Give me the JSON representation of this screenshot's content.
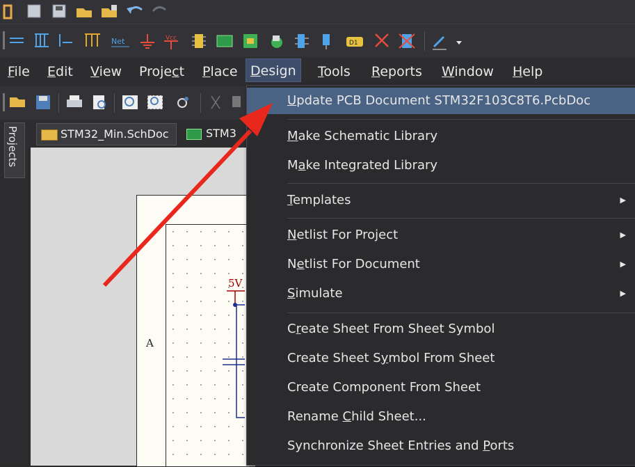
{
  "menubar": {
    "items": [
      {
        "label": "File",
        "ul": "F",
        "rest": "ile"
      },
      {
        "label": "Edit",
        "ul": "E",
        "rest": "dit"
      },
      {
        "label": "View",
        "ul": "V",
        "rest": "iew"
      },
      {
        "label": "Project",
        "pre": "Proje",
        "ul": "c",
        "rest": "t"
      },
      {
        "label": "Place",
        "ul": "P",
        "rest": "lace"
      },
      {
        "label": "Design",
        "ul": "D",
        "rest": "esign"
      },
      {
        "label": "Tools",
        "ul": "T",
        "rest": "ools"
      },
      {
        "label": "Reports",
        "ul": "R",
        "rest": "eports"
      },
      {
        "label": "Window",
        "ul": "W",
        "rest": "indow"
      },
      {
        "label": "Help",
        "ul": "H",
        "rest": "elp"
      }
    ]
  },
  "toolbar_text": {
    "netlabel": "Net",
    "vcc": "Vcc",
    "d1": "D1"
  },
  "panel": {
    "projects_label": "Projects"
  },
  "doc_tabs": [
    {
      "label": "STM32_Min.SchDoc"
    },
    {
      "label": "STM3"
    }
  ],
  "schematic": {
    "zone_label": "A",
    "net_label": "5V"
  },
  "design_menu": {
    "items": [
      {
        "pre": "",
        "ul": "U",
        "rest": "pdate PCB Document STM32F103C8T6.PcbDoc",
        "submenu": false,
        "highlighted": true
      },
      {
        "pre": "",
        "ul": "M",
        "rest": "ake Schematic Library",
        "submenu": false
      },
      {
        "pre": "M",
        "ul": "a",
        "rest": "ke Integrated Library",
        "submenu": false
      },
      {
        "pre": "",
        "ul": "T",
        "rest": "emplates",
        "submenu": true
      },
      {
        "pre": "",
        "ul": "N",
        "rest": "etlist For Project",
        "submenu": true
      },
      {
        "pre": "N",
        "ul": "e",
        "rest": "tlist For Document",
        "submenu": true
      },
      {
        "pre": "",
        "ul": "S",
        "rest": "imulate",
        "submenu": true
      },
      {
        "pre": "C",
        "ul": "r",
        "rest": "eate Sheet From Sheet Symbol",
        "submenu": false
      },
      {
        "pre": "Create Sheet S",
        "ul": "y",
        "rest": "mbol From Sheet",
        "submenu": false
      },
      {
        "pre": "Create Component From Sheet",
        "ul": "",
        "rest": "",
        "submenu": false
      },
      {
        "pre": "Rename ",
        "ul": "C",
        "rest": "hild Sheet...",
        "submenu": false
      },
      {
        "pre": "Synchronize Sheet Entries and ",
        "ul": "P",
        "rest": "orts",
        "submenu": false
      }
    ]
  },
  "colors": {
    "accent": "#4a6384",
    "arrow": "#e8281c"
  }
}
